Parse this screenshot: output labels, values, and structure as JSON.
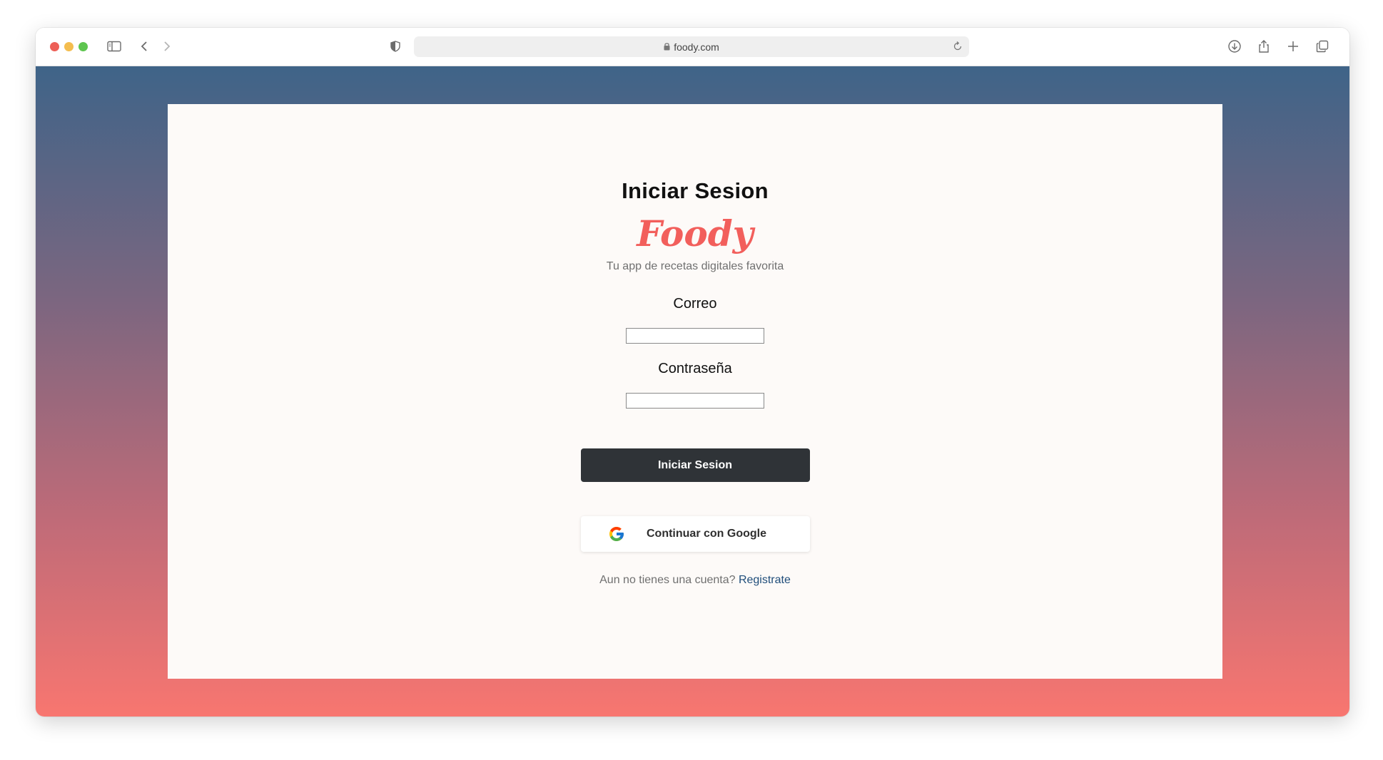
{
  "browser": {
    "url": "foody.com",
    "icons": [
      "sidebar-icon",
      "back-icon",
      "forward-icon",
      "shield-icon",
      "lock-icon",
      "reload-icon",
      "download-icon",
      "share-icon",
      "new-tab-icon",
      "tabs-overview-icon"
    ]
  },
  "login": {
    "title": "Iniciar Sesion",
    "brand": "Foody",
    "tagline": "Tu app de recetas digitales favorita",
    "email_label": "Correo",
    "email_value": "",
    "password_label": "Contraseña",
    "password_value": "",
    "submit_label": "Iniciar Sesion",
    "google_label": "Continuar con Google",
    "register_prompt": "Aun no tienes una cuenta?",
    "register_link": "Registrate"
  },
  "colors": {
    "brand": "#f25f5c",
    "button_dark": "#2f3337",
    "link": "#1f4d7a",
    "gradient_top": "#3f6488",
    "gradient_bottom": "#f87670"
  }
}
